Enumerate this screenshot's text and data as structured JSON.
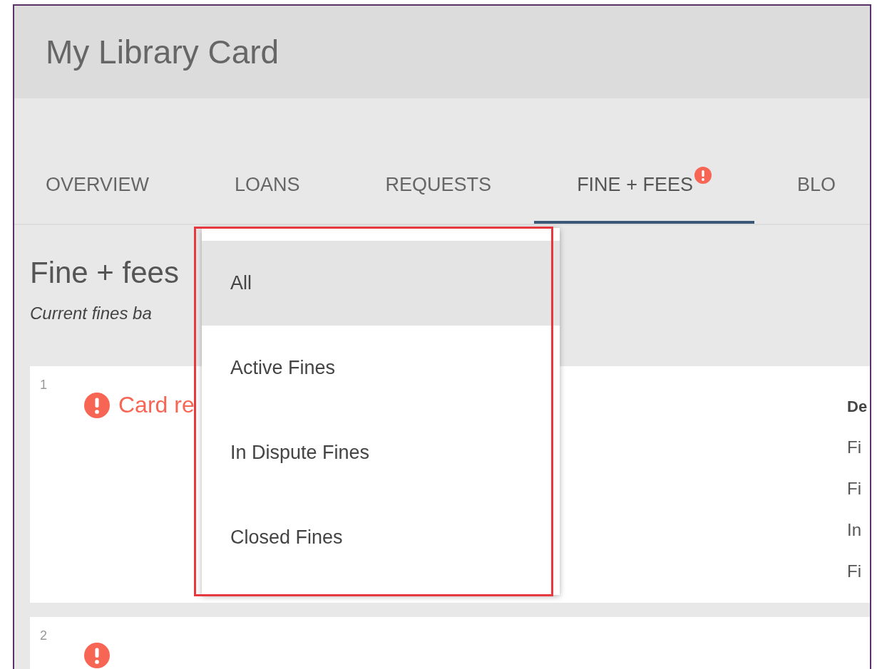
{
  "header": {
    "title": "My Library Card"
  },
  "tabs": [
    {
      "label": "OVERVIEW",
      "selected": false,
      "alert": false
    },
    {
      "label": "LOANS",
      "selected": false,
      "alert": false
    },
    {
      "label": "REQUESTS",
      "selected": false,
      "alert": false
    },
    {
      "label": "FINE + FEES",
      "selected": true,
      "alert": true
    },
    {
      "label": "BLO",
      "selected": false,
      "alert": false
    }
  ],
  "section": {
    "title": "Fine + fees",
    "subtitle": "Current fines ba"
  },
  "fines": [
    {
      "number": "1",
      "alert": true,
      "title": "Card re",
      "details_heading": "De",
      "details": [
        "Fi",
        "Fi",
        "In",
        "Fi"
      ]
    },
    {
      "number": "2",
      "alert": true
    }
  ],
  "filter_menu": {
    "highlighted": true,
    "items": [
      {
        "label": "All",
        "selected": true
      },
      {
        "label": "Active Fines",
        "selected": false
      },
      {
        "label": "In Dispute Fines",
        "selected": false
      },
      {
        "label": "Closed Fines",
        "selected": false
      }
    ]
  }
}
